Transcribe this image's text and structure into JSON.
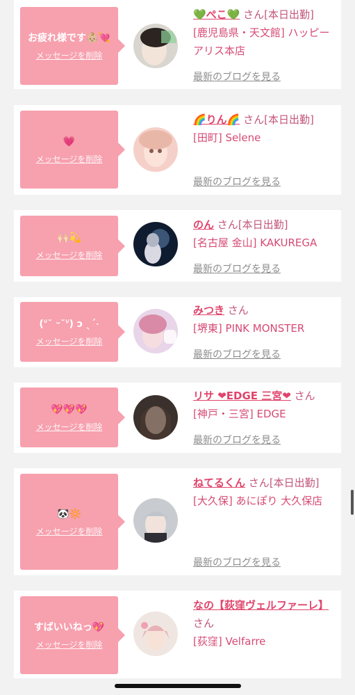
{
  "delete_label": "メッセージを削除",
  "blog_label": "最新のブログを見る",
  "san_label": "さん",
  "cards": [
    {
      "message": "お疲れ様です👶🏼💘",
      "name": "💚ぺこ💚",
      "status": "[本日出勤]",
      "shop": "[鹿児島県・天文館] ハッピーアリス本店"
    },
    {
      "message": "💗",
      "name": "🌈りん🌈",
      "status": "[本日出勤]",
      "shop": "[田町] Selene"
    },
    {
      "message": "🙌🏻💫",
      "name": "のん",
      "status": "[本日出勤]",
      "shop": "[名古屋 金山] KAKUREGA"
    },
    {
      "message": "(ᐡ˘ ᵕ˘ᐡ) ɔ ˎˊ˗",
      "name": "みつき",
      "status": "",
      "shop": "[堺東] PINK MONSTER"
    },
    {
      "message": "💖💖💖",
      "name": "リサ ❤EDGE 三宮❤",
      "status": "",
      "shop": "[神戸・三宮] EDGE"
    },
    {
      "message": "🐼🔆",
      "name": "ねてるくん",
      "status": "[本日出勤]",
      "shop": "[大久保] あにぽり 大久保店"
    },
    {
      "message": "すばいいねっ💖",
      "name": "なの【荻窪ヴェルファーレ】",
      "status": "",
      "shop": "[荻窪] Velfarre"
    }
  ]
}
